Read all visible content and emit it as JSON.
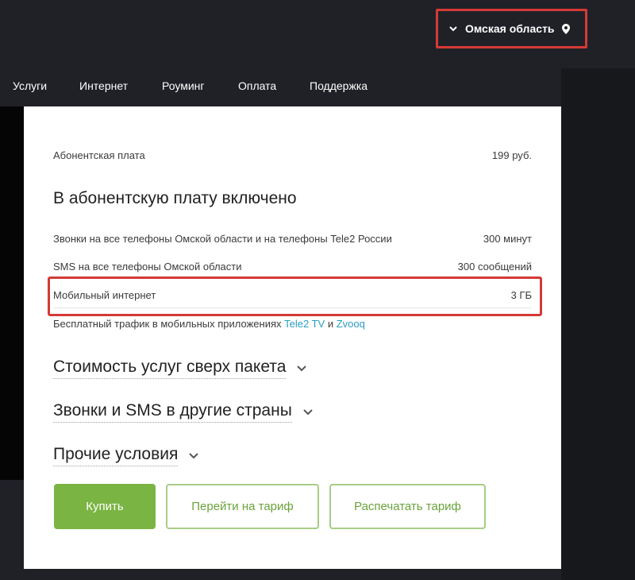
{
  "header": {
    "region": "Омская область",
    "icons": {
      "chevron": "chevron-down-icon",
      "pin": "location-pin-icon"
    }
  },
  "nav": {
    "items": [
      "Услуги",
      "Интернет",
      "Роуминг",
      "Оплата",
      "Поддержка"
    ]
  },
  "tariff": {
    "fee_label": "Абонентская плата",
    "fee_value": "199 руб.",
    "included_title": "В абонентскую плату включено",
    "rows": [
      {
        "label": "Звонки на все телефоны Омской области и на телефоны Tele2 России",
        "value": "300 минут"
      },
      {
        "label": "SMS на все телефоны Омской области",
        "value": "300 сообщений"
      },
      {
        "label": "Мобильный интернет",
        "value": "3 ГБ"
      }
    ],
    "free_traffic": {
      "text": "Бесплатный трафик в мобильных приложениях",
      "link1": "Tele2 TV",
      "conj": "и",
      "link2": "Zvooq"
    },
    "sections": [
      "Стоимость услуг сверх пакета",
      "Звонки и SMS в другие страны",
      "Прочие условия"
    ]
  },
  "buttons": {
    "buy": "Купить",
    "switch": "Перейти на тариф",
    "print": "Распечатать тариф"
  },
  "colors": {
    "background": "#1f2127",
    "highlight": "#d63a36",
    "accent_green": "#7ab442",
    "link": "#2a9dc4"
  }
}
